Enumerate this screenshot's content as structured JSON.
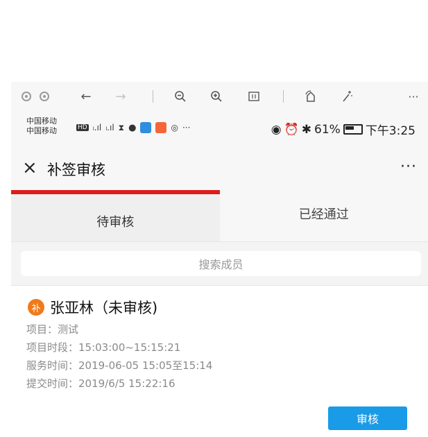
{
  "status_bar": {
    "carrier_1": "中国移动",
    "carrier_2": "中国移动",
    "battery": "61%",
    "time": "下午3:25",
    "more": "···"
  },
  "header": {
    "title": "补签审核",
    "close_icon": "×",
    "more_icon": "···"
  },
  "tabs": [
    {
      "label": "待审核",
      "active": true
    },
    {
      "label": "已经通过",
      "active": false
    }
  ],
  "search": {
    "placeholder": "搜索成员"
  },
  "record": {
    "badge": "补",
    "name": "张亚林（未审核)",
    "project": "项目：测试",
    "time_slot": "项目时段：15:03:00~15:15:21",
    "service_time": "服务时间：2019-06-05 15:05至15:14",
    "submit_time": "提交时间：2019/6/5 15:22:16",
    "review_button": "审核"
  },
  "colors": {
    "tab_indicator": "#e01b1b",
    "badge": "#f07a1a",
    "button": "#1a9be8"
  }
}
